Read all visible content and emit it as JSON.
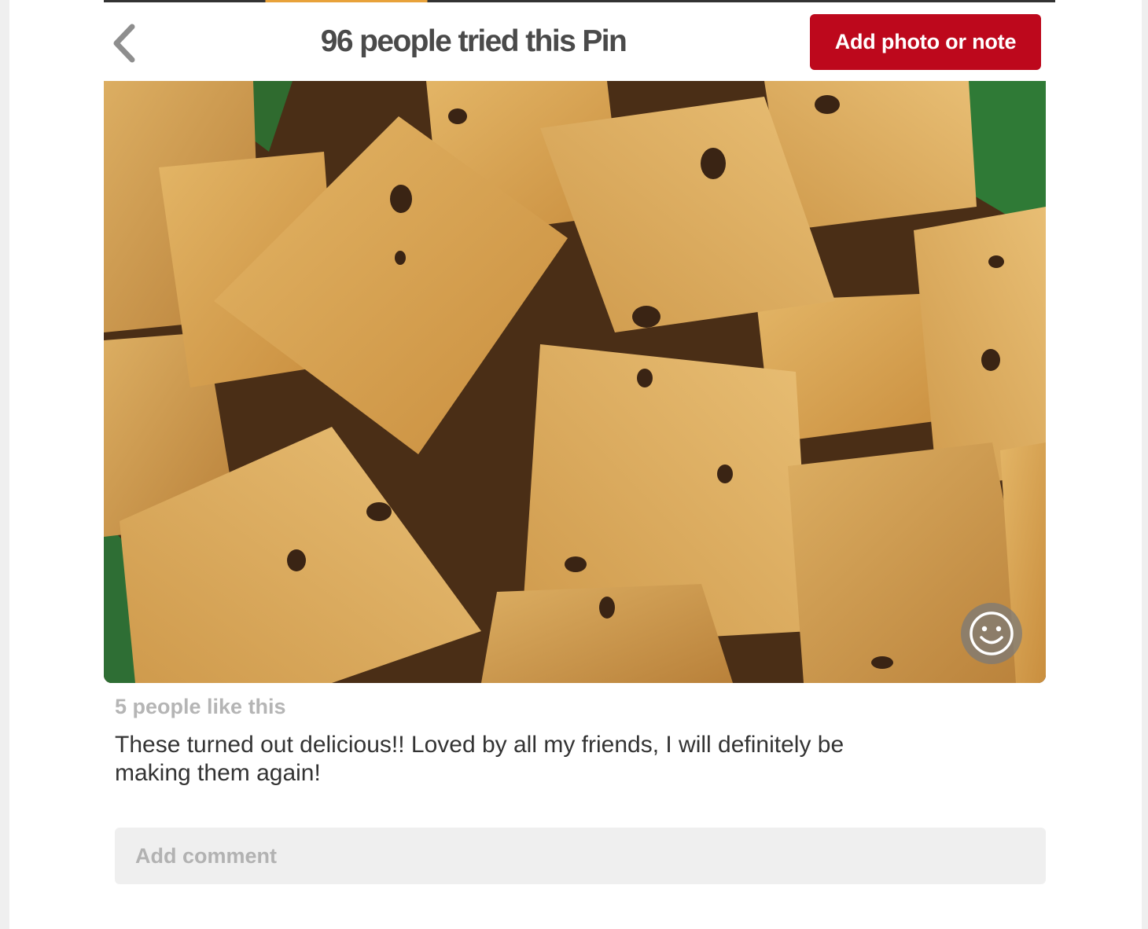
{
  "header": {
    "title": "96 people tried this Pin",
    "add_button_label": "Add photo or note",
    "back_icon": "chevron-left-icon"
  },
  "photo": {
    "description_icon": "smiley-icon"
  },
  "tried_note": {
    "likes": "5 people like this",
    "text": "These turned out delicious!! Loved by all my friends, I will definitely be making them again!"
  },
  "comment": {
    "placeholder": "Add comment"
  },
  "colors": {
    "brand_red": "#bd081c",
    "title_gray": "#4a4a4a",
    "muted_gray": "#b5b5b5",
    "input_bg": "#efefef"
  }
}
